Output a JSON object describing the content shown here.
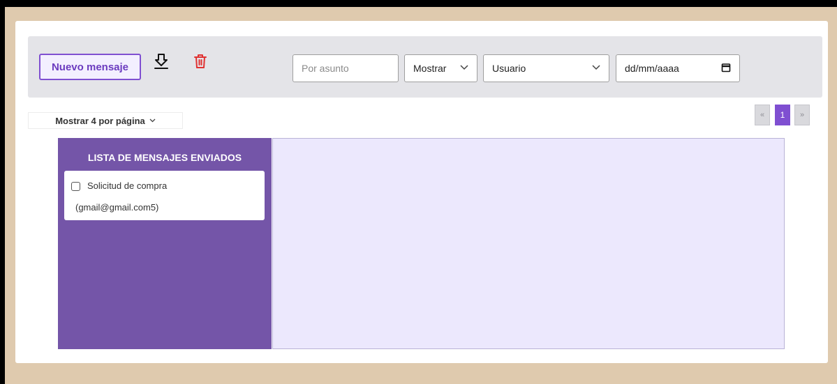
{
  "toolbar": {
    "new_message_label": "Nuevo mensaje",
    "download_icon": "download-icon",
    "trash_icon": "trash-icon",
    "search_placeholder": "Por asunto",
    "show_select_value": "Mostrar",
    "user_select_value": "Usuario",
    "date_placeholder": "dd/mm/aaaa"
  },
  "pagination": {
    "per_page_label": "Mostrar 4 por página",
    "prev_label": "«",
    "current_page": "1",
    "next_label": "»"
  },
  "message_list": {
    "title": "LISTA DE MENSAJES ENVIADOS",
    "items": [
      {
        "subject": "Solicitud de compra",
        "email": "(gmail@gmail.com5)",
        "checked": false
      }
    ]
  },
  "colors": {
    "accent": "#7f4fd1",
    "panel": "#7455a8",
    "preview_bg": "#ece8fd",
    "trash": "#e03131",
    "outer_bg": "#dfcaae"
  }
}
